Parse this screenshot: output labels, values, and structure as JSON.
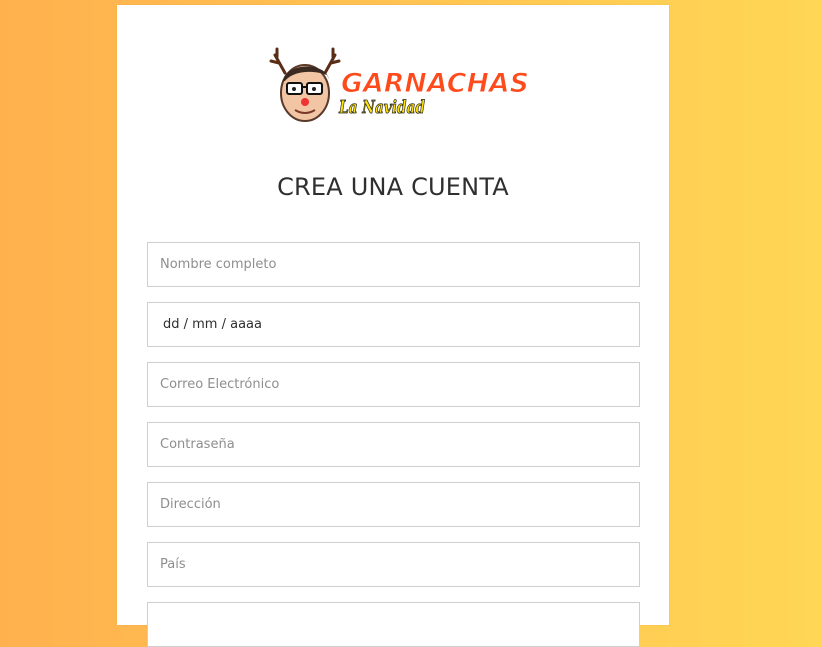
{
  "colors": {
    "background_left": "#FFB14E",
    "background_right": "#FFD655",
    "card": "#FFFFFF",
    "logo_orange": "#FF4A1C",
    "logo_yellow": "#FFE000"
  },
  "logo": {
    "line1": "GARNACHAS",
    "line2": "La Navidad"
  },
  "form": {
    "title": "CREA UNA CUENTA",
    "full_name_placeholder": "Nombre completo",
    "birthdate_value": "dd / mm / aaaa",
    "email_placeholder": "Correo Electrónico",
    "password_placeholder": "Contraseña",
    "address_placeholder": "Dirección",
    "country_placeholder": "País"
  }
}
